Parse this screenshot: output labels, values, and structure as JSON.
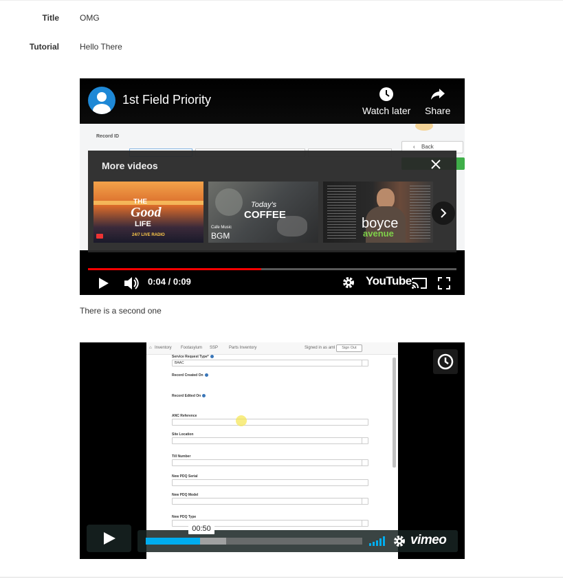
{
  "fields": [
    {
      "label": "Title",
      "value": "OMG"
    },
    {
      "label": "Tutorial",
      "value": "Hello There"
    }
  ],
  "youtube": {
    "title": "1st Field Priority",
    "watch_later": "Watch later",
    "share": "Share",
    "more_videos": "More videos",
    "time": "0:04 / 0:09",
    "logo": "YouTube",
    "progress_fraction": 0.47,
    "colors": {
      "progress": "#ff0000",
      "avatar": "#1e88d6"
    },
    "screen": {
      "record_label": "Record ID",
      "back_button": "Back"
    },
    "thumbnails": [
      {
        "lines": [
          "THE",
          "Good",
          "LIFE",
          "24/7 LIVE RADIO"
        ]
      },
      {
        "lines": [
          "Today's",
          "COFFEE",
          "Cafe Music",
          "BGM"
        ]
      },
      {
        "lines": [
          "boyce",
          "avenue"
        ]
      }
    ]
  },
  "second_text": "There is a second one",
  "vimeo": {
    "tooltip": "00:50",
    "logo": "vimeo",
    "progress_fraction": 0.25,
    "loaded_fraction": 0.37,
    "colors": {
      "progress": "#00adef"
    },
    "screen": {
      "nav": [
        "Inventory",
        "Footasylum",
        "SSP",
        "Parts Inventory"
      ],
      "signed_in": "Signed in as aml",
      "sign_out": "Sign Out",
      "fields": [
        {
          "label": "Service Request Type*",
          "value": "BAAC",
          "type": "select"
        },
        {
          "label": "Record Created On",
          "value": "",
          "type": "none"
        },
        {
          "label": "Record Edited On",
          "value": "",
          "type": "none"
        },
        {
          "label": "ANC Reference",
          "value": "",
          "type": "text"
        },
        {
          "label": "Site Location",
          "value": "",
          "type": "select"
        },
        {
          "label": "Till Number",
          "value": "",
          "type": "select"
        },
        {
          "label": "New PDQ Serial",
          "value": "",
          "type": "text"
        },
        {
          "label": "New PDQ Model",
          "value": "",
          "type": "select"
        },
        {
          "label": "New PDQ Type",
          "value": "",
          "type": "select"
        }
      ]
    }
  }
}
